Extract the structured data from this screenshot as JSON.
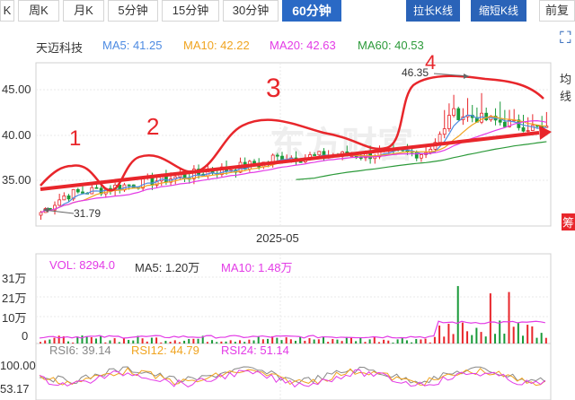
{
  "tabs": [
    {
      "label": "K",
      "active": false
    },
    {
      "label": "周K",
      "active": false
    },
    {
      "label": "月K",
      "active": false
    },
    {
      "label": "5分钟",
      "active": false
    },
    {
      "label": "15分钟",
      "active": false
    },
    {
      "label": "30分钟",
      "active": false
    },
    {
      "label": "60分钟",
      "active": true
    }
  ],
  "zoom_in_label": "拉长K线",
  "zoom_out_label": "缩短K线",
  "adjust_label": "前复",
  "main_legend": {
    "name": "天迈科技",
    "ma5": "MA5: 41.25",
    "ma10": "MA10: 42.22",
    "ma20": "MA20: 42.63",
    "ma60": "MA60: 40.53"
  },
  "price_axis": [
    "45.00",
    "40.00",
    "35.00"
  ],
  "max_label": "46.35",
  "min_label": "31.79",
  "date_label": "2025-05",
  "volume_legend": {
    "vol": "VOL: 8294.0",
    "ma5": "MA5: 1.20万",
    "ma10": "MA10: 1.48万"
  },
  "volume_axis": [
    "31万",
    "21万",
    "10万",
    "0"
  ],
  "rsi_legend": {
    "rsi6": "RSI6: 39.14",
    "rsi12": "RSI12: 44.79",
    "rsi24": "RSI24: 51.14"
  },
  "rsi_axis": [
    "100.00",
    "53.17"
  ],
  "side_labels": {
    "avg": "均线",
    "icon": "⛶",
    "badge": "筹"
  },
  "annotations": [
    "1",
    "2",
    "3",
    "4"
  ],
  "watermark": "东方财富",
  "colors": {
    "up": "#e8262b",
    "down": "#1a9a3a",
    "ma5": "#4e8be2",
    "ma10": "#f0a420",
    "ma20": "#e33be6",
    "ma60": "#2c9a3a",
    "vol": "#e33be6",
    "rsi6": "#888888",
    "rsi12": "#f0a420",
    "rsi24": "#e33be6",
    "tab_active": "#2a69c5",
    "zoom_btn": "#2a63b8"
  }
}
